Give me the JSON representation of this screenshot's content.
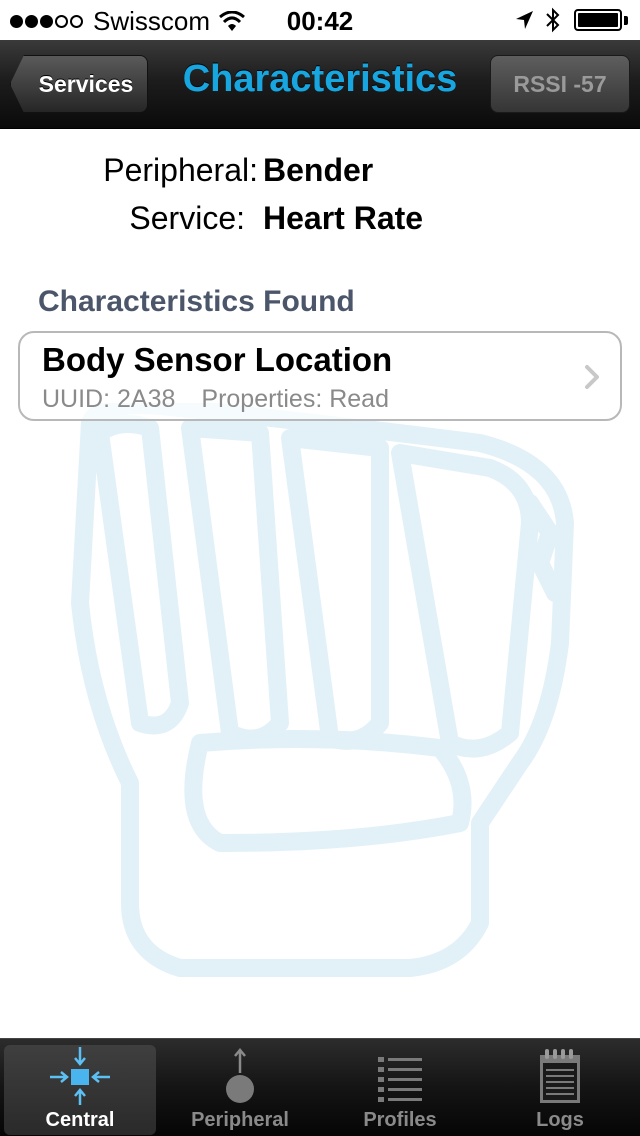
{
  "status_bar": {
    "carrier": "Swisscom",
    "time": "00:42",
    "signal_bars": 3,
    "signal_total": 5,
    "battery_level": 1.0
  },
  "nav": {
    "back_label": "Services",
    "title": "Characteristics",
    "rssi_label": "RSSI -57",
    "title_color": "#18a6e0"
  },
  "info": {
    "peripheral_label": "Peripheral:",
    "peripheral_value": "Bender",
    "service_label": "Service:",
    "service_value": "Heart Rate"
  },
  "section": {
    "title": "Characteristics Found"
  },
  "characteristics": [
    {
      "name": "Body Sensor Location",
      "uuid": "UUID: 2A38",
      "properties": "Properties: Read"
    }
  ],
  "tabs": [
    {
      "label": "Central",
      "icon": "central-icon",
      "selected": true
    },
    {
      "label": "Peripheral",
      "icon": "peripheral-icon",
      "selected": false
    },
    {
      "label": "Profiles",
      "icon": "profiles-list-icon",
      "selected": false
    },
    {
      "label": "Logs",
      "icon": "logs-notepad-icon",
      "selected": false
    }
  ]
}
